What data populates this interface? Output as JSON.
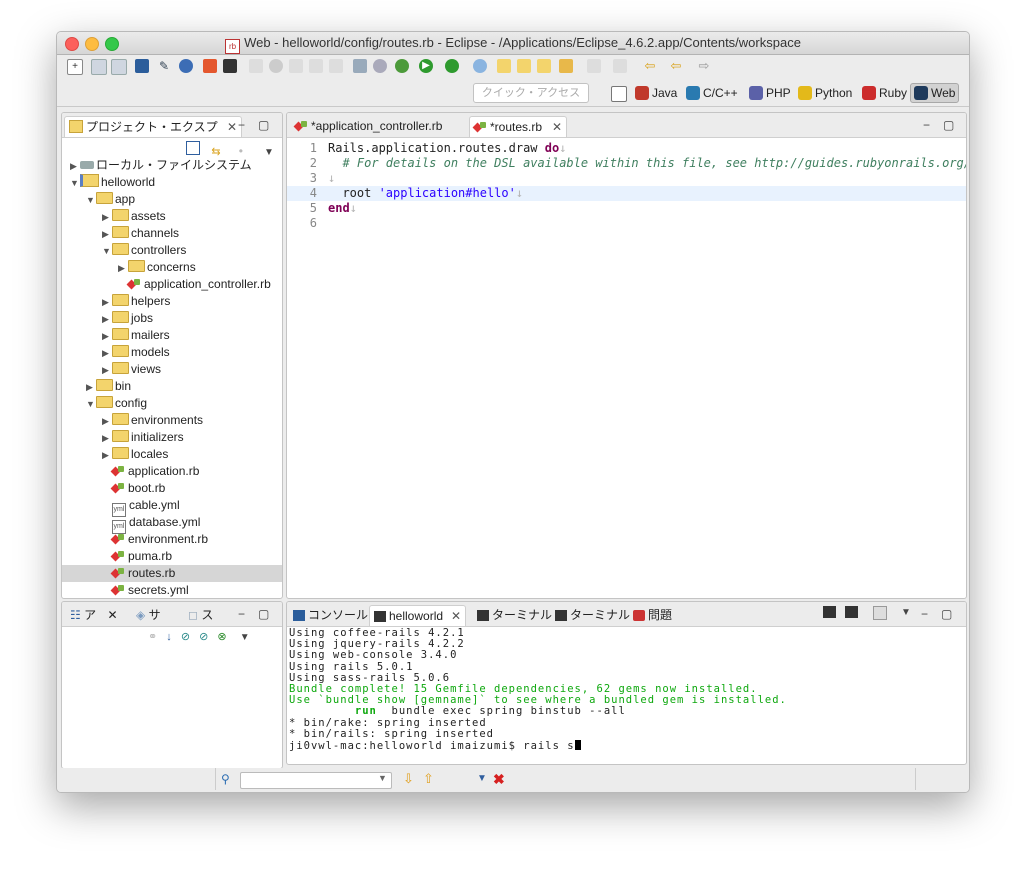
{
  "window": {
    "title": "Web - helloworld/config/routes.rb - Eclipse - /Applications/Eclipse_4.6.2.app/Contents/workspace",
    "title_icon": "rb"
  },
  "toolbar": {
    "quick_access_placeholder": "クイック・アクセス",
    "perspectives": [
      {
        "label": "Java",
        "icon": "java-perspective-icon",
        "color": "#c0392b"
      },
      {
        "label": "C/C++",
        "icon": "cpp-perspective-icon",
        "color": "#2a7ab0"
      },
      {
        "label": "PHP",
        "icon": "php-perspective-icon",
        "color": "#5b61a8"
      },
      {
        "label": "Python",
        "icon": "python-perspective-icon",
        "color": "#e3b91a"
      },
      {
        "label": "Ruby",
        "icon": "ruby-perspective-icon",
        "color": "#cc2c2c"
      },
      {
        "label": "Web",
        "icon": "web-perspective-icon",
        "color": "#1e3a5c"
      }
    ]
  },
  "explorer": {
    "tab_label": "プロジェクト・エクスプ",
    "tree": [
      {
        "label": "ローカル・ファイルシステム",
        "indent": 0,
        "twisty": "▶",
        "icon": "drive"
      },
      {
        "label": "helloworld",
        "indent": 0,
        "twisty": "▼",
        "icon": "project"
      },
      {
        "label": "app",
        "indent": 1,
        "twisty": "▼",
        "icon": "folder"
      },
      {
        "label": "assets",
        "indent": 2,
        "twisty": "▶",
        "icon": "folder"
      },
      {
        "label": "channels",
        "indent": 2,
        "twisty": "▶",
        "icon": "folder"
      },
      {
        "label": "controllers",
        "indent": 2,
        "twisty": "▼",
        "icon": "folder"
      },
      {
        "label": "concerns",
        "indent": 3,
        "twisty": "▶",
        "icon": "folder"
      },
      {
        "label": "application_controller.rb",
        "indent": 3,
        "twisty": "",
        "icon": "ruby"
      },
      {
        "label": "helpers",
        "indent": 2,
        "twisty": "▶",
        "icon": "folder"
      },
      {
        "label": "jobs",
        "indent": 2,
        "twisty": "▶",
        "icon": "folder"
      },
      {
        "label": "mailers",
        "indent": 2,
        "twisty": "▶",
        "icon": "folder"
      },
      {
        "label": "models",
        "indent": 2,
        "twisty": "▶",
        "icon": "folder"
      },
      {
        "label": "views",
        "indent": 2,
        "twisty": "▶",
        "icon": "folder"
      },
      {
        "label": "bin",
        "indent": 1,
        "twisty": "▶",
        "icon": "folder"
      },
      {
        "label": "config",
        "indent": 1,
        "twisty": "▼",
        "icon": "folder"
      },
      {
        "label": "environments",
        "indent": 2,
        "twisty": "▶",
        "icon": "folder"
      },
      {
        "label": "initializers",
        "indent": 2,
        "twisty": "▶",
        "icon": "folder"
      },
      {
        "label": "locales",
        "indent": 2,
        "twisty": "▶",
        "icon": "folder"
      },
      {
        "label": "application.rb",
        "indent": 2,
        "twisty": "",
        "icon": "ruby"
      },
      {
        "label": "boot.rb",
        "indent": 2,
        "twisty": "",
        "icon": "ruby"
      },
      {
        "label": "cable.yml",
        "indent": 2,
        "twisty": "",
        "icon": "yml"
      },
      {
        "label": "database.yml",
        "indent": 2,
        "twisty": "",
        "icon": "yml"
      },
      {
        "label": "environment.rb",
        "indent": 2,
        "twisty": "",
        "icon": "ruby"
      },
      {
        "label": "puma.rb",
        "indent": 2,
        "twisty": "",
        "icon": "ruby"
      },
      {
        "label": "routes.rb",
        "indent": 2,
        "twisty": "",
        "icon": "ruby",
        "selected": true
      },
      {
        "label": "secrets.yml",
        "indent": 2,
        "twisty": "",
        "icon": "ruby"
      }
    ]
  },
  "outline": {
    "tabs": [
      "ア",
      "サ",
      "ス"
    ]
  },
  "editor": {
    "tabs": [
      {
        "label": "*application_controller.rb",
        "active": false
      },
      {
        "label": "*routes.rb",
        "active": true
      }
    ],
    "lines": [
      {
        "num": "1",
        "text": "Rails.application.routes.draw do"
      },
      {
        "num": "2",
        "text": "  # For details on the DSL available within this file, see http://guides.rubyonrails.org/"
      },
      {
        "num": "3",
        "text": ""
      },
      {
        "num": "4",
        "text": "  root 'application#hello'"
      },
      {
        "num": "5",
        "text": "end"
      },
      {
        "num": "6",
        "text": ""
      }
    ]
  },
  "console": {
    "tabs": [
      {
        "label": "コンソール",
        "active": false
      },
      {
        "label": "helloworld",
        "active": true
      },
      {
        "label": "ターミナル",
        "active": false
      },
      {
        "label": "ターミナル",
        "active": false
      },
      {
        "label": "問題",
        "active": false
      }
    ],
    "lines": [
      {
        "text": "Using coffee-rails 4.2.1",
        "style": "normal"
      },
      {
        "text": "Using jquery-rails 4.2.2",
        "style": "normal"
      },
      {
        "text": "Using web-console 3.4.0",
        "style": "normal"
      },
      {
        "text": "Using rails 5.0.1",
        "style": "normal"
      },
      {
        "text": "Using sass-rails 5.0.6",
        "style": "normal"
      },
      {
        "text": "Bundle complete! 15 Gemfile dependencies, 62 gems now installed.",
        "style": "green"
      },
      {
        "text": "Use `bundle show [gemname]` to see where a bundled gem is installed.",
        "style": "green"
      },
      {
        "prefix": "         run",
        "text": "  bundle exec spring binstub --all",
        "style": "run"
      },
      {
        "text": "* bin/rake: spring inserted",
        "style": "normal"
      },
      {
        "text": "* bin/rails: spring inserted",
        "style": "normal"
      },
      {
        "text": "ji0vwl-mac:helloworld imaizumi$ rails s",
        "style": "prompt"
      }
    ]
  }
}
